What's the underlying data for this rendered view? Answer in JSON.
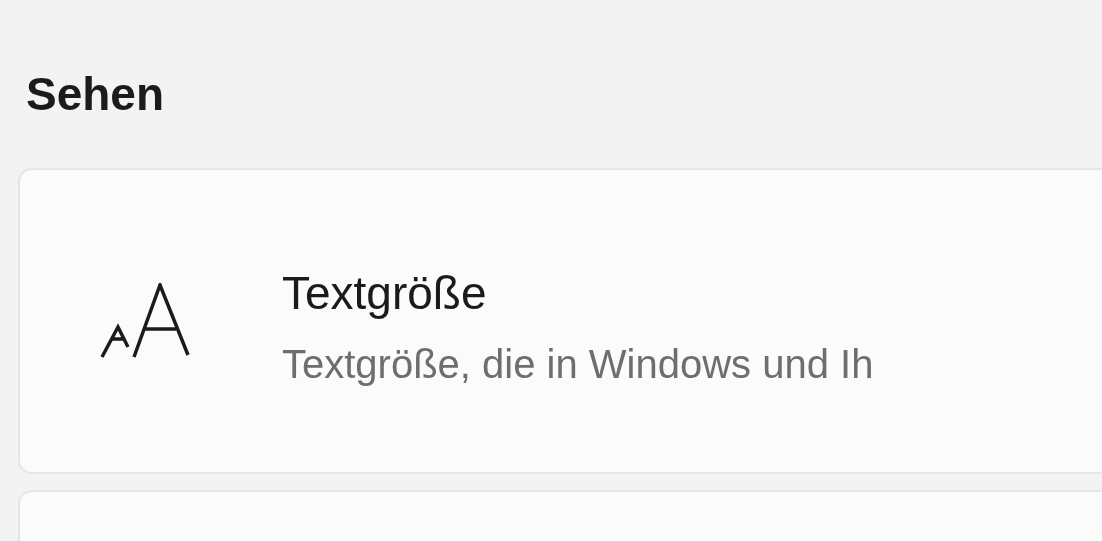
{
  "section": {
    "title": "Sehen"
  },
  "cards": [
    {
      "title": "Textgröße",
      "description": "Textgröße, die in Windows und Ih"
    }
  ]
}
